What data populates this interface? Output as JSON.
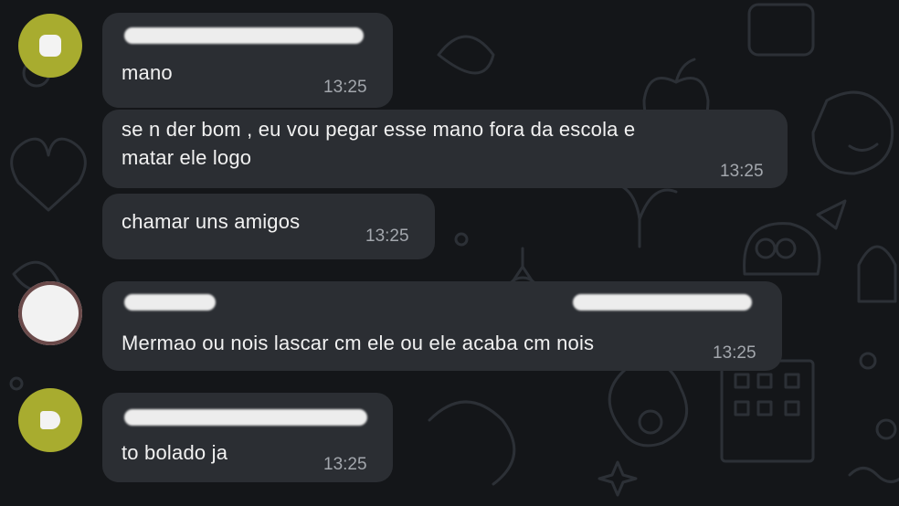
{
  "colors": {
    "background": "#141619",
    "bubble": "#2b2e33",
    "message_text": "#f1f1f1",
    "timestamp": "#a3a7ad",
    "avatar_olive": "#a8ac2f"
  },
  "messages": [
    {
      "text": "mano",
      "time": "13:25"
    },
    {
      "text": "se n der bom , eu vou pegar esse mano fora da escola e\nmatar ele logo",
      "time": "13:25"
    },
    {
      "text": "chamar uns amigos",
      "time": "13:25"
    },
    {
      "text": "Mermao ou nois lascar cm ele ou ele acaba cm nois",
      "time": "13:25"
    },
    {
      "text": "to bolado ja",
      "time": "13:25"
    }
  ]
}
